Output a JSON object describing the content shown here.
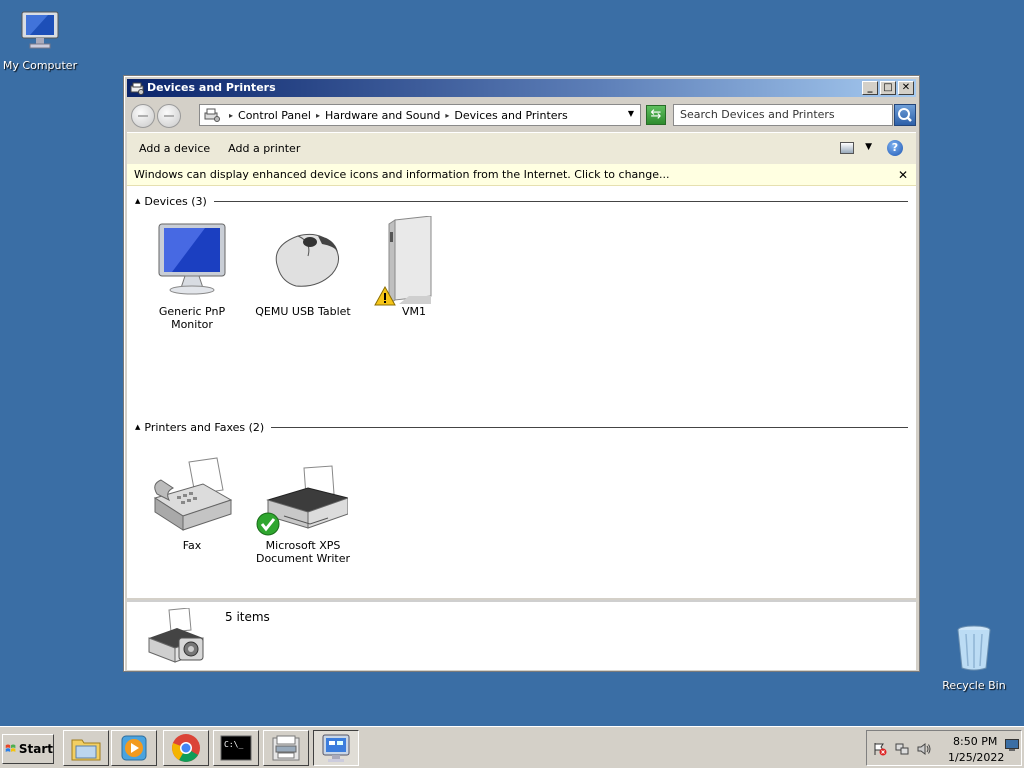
{
  "desktop": {
    "my_computer_label": "My Computer",
    "recycle_bin_label": "Recycle Bin"
  },
  "window": {
    "title": "Devices and Printers",
    "min_glyph": "_",
    "max_glyph": "□",
    "close_glyph": "✕",
    "breadcrumb": [
      "Control Panel",
      "Hardware and Sound",
      "Devices and Printers"
    ],
    "search_placeholder": "Search Devices and Printers",
    "commands": {
      "add_device": "Add a device",
      "add_printer": "Add a printer"
    },
    "help_glyph": "?",
    "infobar": {
      "text": "Windows can display enhanced device icons and information from the Internet. Click to change...",
      "close_glyph": "✕"
    },
    "groups": {
      "devices": {
        "header": "Devices (3)",
        "items": [
          {
            "name_line1": "Generic PnP",
            "name_line2": "Monitor",
            "icon": "monitor-icon"
          },
          {
            "name_line1": "QEMU USB Tablet",
            "name_line2": "",
            "icon": "mouse-icon"
          },
          {
            "name_line1": "VM1",
            "name_line2": "",
            "icon": "computer-tower-icon",
            "warning": true
          }
        ]
      },
      "printers": {
        "header": "Printers and Faxes (2)",
        "items": [
          {
            "name_line1": "Fax",
            "name_line2": "",
            "icon": "fax-icon"
          },
          {
            "name_line1": "Microsoft XPS",
            "name_line2": "Document Writer",
            "icon": "printer-icon",
            "default": true
          }
        ]
      }
    },
    "details": {
      "count": "5 items"
    }
  },
  "taskbar": {
    "start_label": "Start",
    "apps": [
      "file-explorer-icon",
      "media-player-icon",
      "chrome-icon",
      "command-prompt-icon",
      "printer-folder-icon",
      "devices-and-printers-icon"
    ],
    "clock_time": "8:50 PM",
    "clock_date": "1/25/2022"
  },
  "colors": {
    "desktop": "#3a6ea5",
    "title_start": "#0a246a",
    "title_end": "#a6caf0",
    "infobar": "#ffffe1"
  }
}
